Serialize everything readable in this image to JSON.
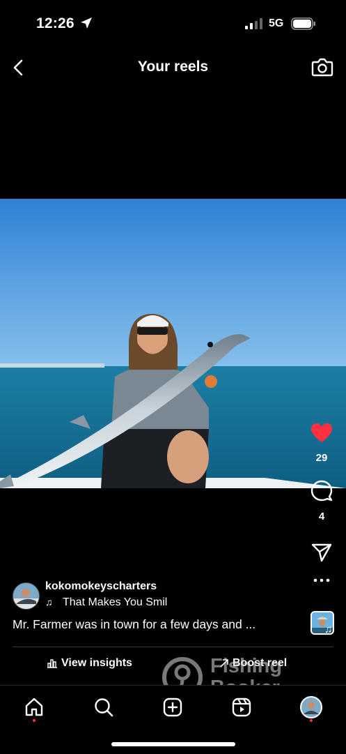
{
  "status_bar": {
    "time": "12:26",
    "network": "5G"
  },
  "header": {
    "title": "Your reels"
  },
  "reel": {
    "likes": "29",
    "comments": "4",
    "username": "kokomokeyscharters",
    "music": "That Makes You Smil",
    "caption": "Mr. Farmer was in town for a few days and ..."
  },
  "actions": {
    "insights_label": "View insights",
    "boost_label": "Boost reel"
  },
  "watermark": {
    "line1": "Fishing",
    "line2": "Booker"
  },
  "colors": {
    "like": "#ff3040",
    "background": "#000000"
  }
}
